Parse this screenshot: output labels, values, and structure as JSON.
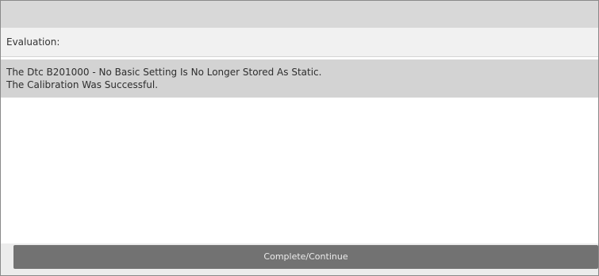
{
  "evaluation": {
    "label": "Evaluation:"
  },
  "message": {
    "lines": [
      "The Dtc B201000 - No Basic Setting Is No Longer Stored As Static.",
      "The Calibration Was Successful."
    ]
  },
  "actions": {
    "continue_label": "Complete/Continue"
  },
  "colors": {
    "top_bar": "#d8d8d8",
    "header_bg": "#f1f1f1",
    "message_bg": "#d3d3d3",
    "button_bg": "#727272",
    "button_text": "#ececec"
  }
}
